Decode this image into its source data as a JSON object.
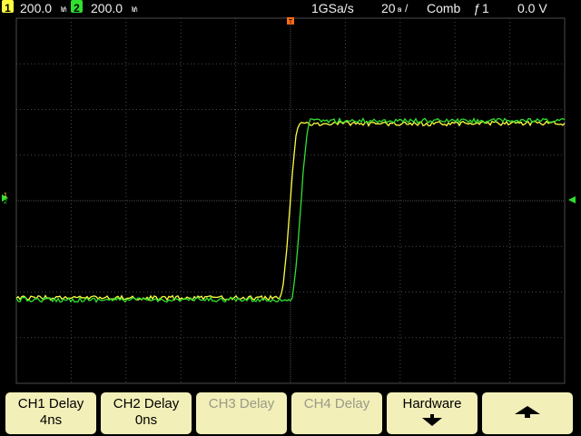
{
  "status": {
    "ch1_number": "1",
    "ch1_scale": "200.0",
    "ch1_unit_top": "m",
    "ch1_unit_bottom": "V",
    "ch2_number": "2",
    "ch2_scale": "200.0",
    "ch2_unit_top": "m",
    "ch2_unit_bottom": "V",
    "sample_rate": "1GSa/s",
    "timebase": "20",
    "timebase_unit_top": "n",
    "timebase_unit_bottom": "s",
    "acq_mode": "Comb",
    "trigger_source": "1",
    "trigger_level": "0.0 V"
  },
  "colors": {
    "ch1": "#ffff40",
    "ch2": "#30e030",
    "trigger_marker": "#ff6a1a",
    "grid": "#4a4a4a",
    "softkey_bg": "#f2efb8"
  },
  "markers": {
    "ch1_ground_label": "1",
    "ch2_ground_label": "2"
  },
  "softkeys": [
    {
      "line1": "CH1 Delay",
      "line2": "4ns",
      "enabled": true
    },
    {
      "line1": "CH2 Delay",
      "line2": "0ns",
      "enabled": true
    },
    {
      "line1": "CH3 Delay",
      "line2": "",
      "enabled": false
    },
    {
      "line1": "CH4 Delay",
      "line2": "",
      "enabled": false
    },
    {
      "line1": "Hardware",
      "line2": "",
      "enabled": true,
      "icon": "down-arrow-icon"
    },
    {
      "line1": "",
      "line2": "",
      "enabled": true,
      "icon": "up-arrow-icon"
    }
  ]
}
